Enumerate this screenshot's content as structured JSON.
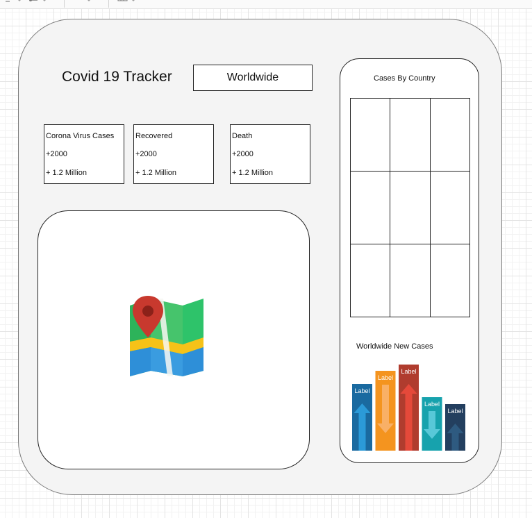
{
  "header": {
    "title": "Covid 19 Tracker"
  },
  "region_select": {
    "value": "Worldwide"
  },
  "stats": [
    {
      "title": "Corona Virus Cases",
      "today": "+2000",
      "total": "+ 1.2 Million"
    },
    {
      "title": "Recovered",
      "today": "+2000",
      "total": "+ 1.2 Million"
    },
    {
      "title": "Death",
      "today": "+2000",
      "total": "+ 1.2 Million"
    }
  ],
  "map": {
    "icon": "map-pin-icon"
  },
  "side": {
    "country_title": "Cases By Country",
    "country_table": {
      "rows": 3,
      "cols": 3
    },
    "new_cases_title": "Worldwide New Cases"
  },
  "chart_data": {
    "type": "bar",
    "categories": [
      "Label",
      "Label",
      "Label",
      "Label",
      "Label"
    ],
    "values": [
      96,
      115,
      124,
      77,
      67
    ],
    "colors": [
      "#1a6aa0",
      "#f4941f",
      "#b03c2e",
      "#17a2ad",
      "#233f5f"
    ],
    "arrow_colors": [
      "#2b9ad8",
      "#f9b066",
      "#e5493a",
      "#58c8d8",
      "#2e5a80"
    ],
    "arrows": [
      "up",
      "down",
      "up",
      "down",
      "up"
    ],
    "xlabel": "",
    "ylabel": ""
  }
}
